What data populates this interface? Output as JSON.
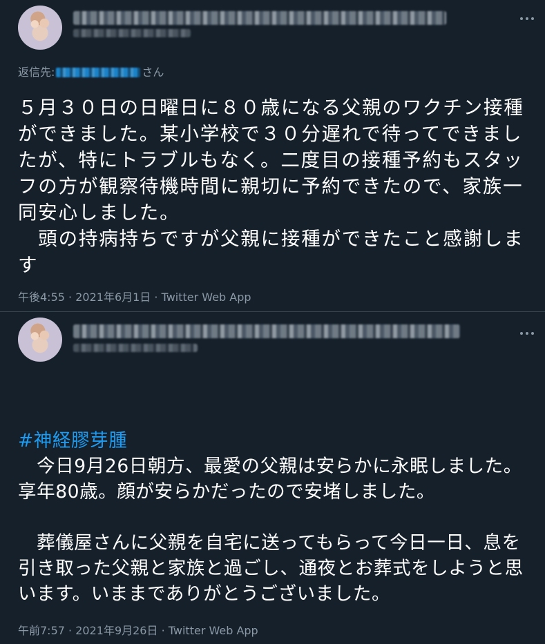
{
  "tweets": [
    {
      "reply_prefix": "返信先:",
      "reply_suffix": "さん",
      "text": "５月３０日の日曜日に８０歳になる父親のワクチン接種ができました。某小学校で３０分遅れで待ってできましたが、特にトラブルもなく。二度目の接種予約もスタッフの方が観察待機時間に親切に予約できたので、家族一同安心しました。\n　頭の持病持ちですが父親に接種ができたこと感謝します",
      "time": "午後4:55",
      "date": "2021年6月1日",
      "source": "Twitter Web App",
      "sep": "·"
    },
    {
      "hashtag": "#神経膠芽腫",
      "text": "　今日9月26日朝方、最愛の父親は安らかに永眠しました。享年80歳。顔が安らかだったので安堵しました。\n\n　葬儀屋さんに父親を自宅に送ってもらって今日一日、息を引き取った父親と家族と過ごし、通夜とお葬式をしようと思います。いままでありがとうございました。",
      "time": "午前7:57",
      "date": "2021年9月26日",
      "source": "Twitter Web App",
      "sep": "·"
    }
  ],
  "colors": {
    "background": "#15202b",
    "text": "#ffffff",
    "secondary": "#8b98a5",
    "accent": "#1d9bf0",
    "divider": "#38444d"
  },
  "icons": [
    "avatar",
    "more-icon"
  ]
}
